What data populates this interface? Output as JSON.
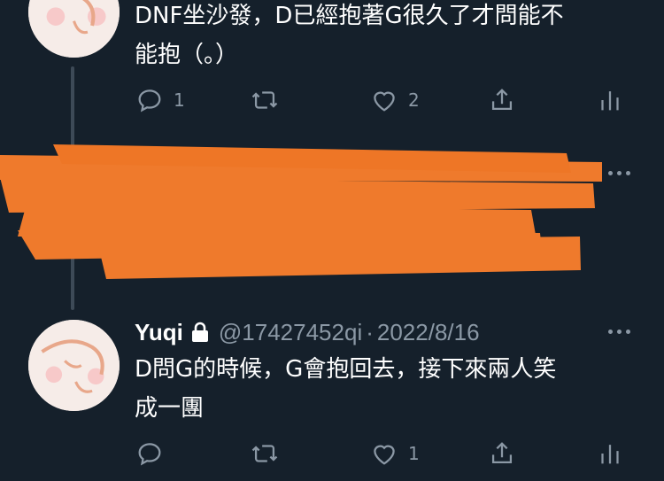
{
  "tweet1": {
    "text_line1": "DNF坐沙發，D已經抱著G很久了才問能不",
    "text_line2": "能抱（。）",
    "reply_count": "1",
    "like_count": "2",
    "icons": [
      "reply-icon",
      "retweet-icon",
      "like-icon",
      "share-icon",
      "analytics-icon"
    ]
  },
  "tweet2": {
    "name": "Yuqi",
    "handle": "@17427452qi",
    "separator": "·",
    "date": "2022/8/16",
    "text_line1": "D問G的時候，G會抱回去，接下來兩人笑",
    "text_line2": "成一團",
    "reply_count": "",
    "retweet_count": "",
    "like_count": "1",
    "icons": [
      "reply-icon",
      "retweet-icon",
      "like-icon",
      "share-icon",
      "analytics-icon"
    ]
  },
  "colors": {
    "background": "#15202b",
    "text": "#ffffff",
    "secondary": "#8b98a5",
    "redaction": "#ef7a2c",
    "thread_line": "#3d4a57"
  }
}
